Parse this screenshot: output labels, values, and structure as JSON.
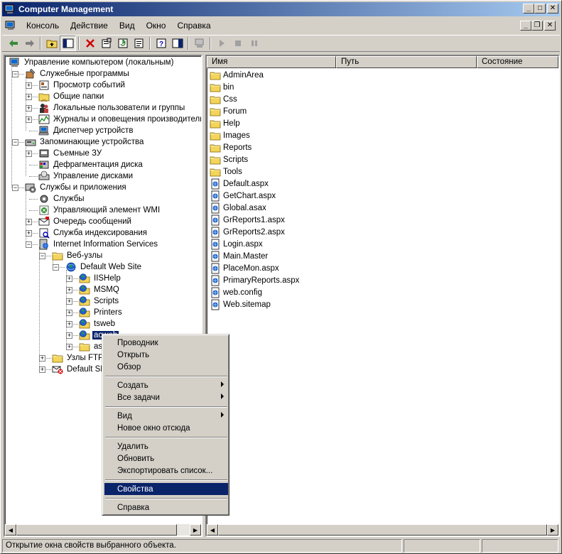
{
  "window": {
    "title": "Computer Management"
  },
  "menubar": {
    "items": [
      "Консоль",
      "Действие",
      "Вид",
      "Окно",
      "Справка"
    ]
  },
  "tree": {
    "items": [
      {
        "label": "Управление компьютером (локальным)",
        "icon": "computer-icon"
      },
      {
        "label": "Служебные программы",
        "icon": "tools-icon"
      },
      {
        "label": "Просмотр событий",
        "icon": "event-viewer-icon"
      },
      {
        "label": "Общие папки",
        "icon": "shared-folder-icon"
      },
      {
        "label": "Локальные пользователи и группы",
        "icon": "users-icon"
      },
      {
        "label": "Журналы и оповещения производительно",
        "icon": "performance-icon"
      },
      {
        "label": "Диспетчер устройств",
        "icon": "device-manager-icon"
      },
      {
        "label": "Запоминающие устройства",
        "icon": "storage-icon"
      },
      {
        "label": "Съемные ЗУ",
        "icon": "removable-storage-icon"
      },
      {
        "label": "Дефрагментация диска",
        "icon": "defrag-icon"
      },
      {
        "label": "Управление дисками",
        "icon": "disk-management-icon"
      },
      {
        "label": "Службы и приложения",
        "icon": "services-apps-icon"
      },
      {
        "label": "Службы",
        "icon": "services-icon"
      },
      {
        "label": "Управляющий элемент WMI",
        "icon": "wmi-icon"
      },
      {
        "label": "Очередь сообщений",
        "icon": "message-queue-icon"
      },
      {
        "label": "Служба индексирования",
        "icon": "indexing-icon"
      },
      {
        "label": "Internet Information Services",
        "icon": "iis-icon"
      },
      {
        "label": "Веб-узлы",
        "icon": "folder-icon"
      },
      {
        "label": "Default Web Site",
        "icon": "website-icon"
      },
      {
        "label": "IISHelp",
        "icon": "web-folder-icon"
      },
      {
        "label": "MSMQ",
        "icon": "web-folder-icon"
      },
      {
        "label": "Scripts",
        "icon": "web-folder-icon"
      },
      {
        "label": "Printers",
        "icon": "web-folder-icon"
      },
      {
        "label": "tsweb",
        "icon": "web-folder-icon"
      },
      {
        "label": "acweb",
        "icon": "web-folder-icon"
      },
      {
        "label": "aspn",
        "icon": "folder-icon"
      },
      {
        "label": "Узлы FTP",
        "icon": "folder-icon"
      },
      {
        "label": "Default SMT",
        "icon": "smtp-icon"
      }
    ]
  },
  "list": {
    "columns": [
      "Имя",
      "Путь",
      "Состояние"
    ],
    "rows": [
      {
        "name": "AdminArea",
        "icon": "folder-icon"
      },
      {
        "name": "bin",
        "icon": "folder-icon"
      },
      {
        "name": "Css",
        "icon": "folder-icon"
      },
      {
        "name": "Forum",
        "icon": "folder-icon"
      },
      {
        "name": "Help",
        "icon": "folder-icon"
      },
      {
        "name": "Images",
        "icon": "folder-icon"
      },
      {
        "name": "Reports",
        "icon": "folder-icon"
      },
      {
        "name": "Scripts",
        "icon": "folder-icon"
      },
      {
        "name": "Tools",
        "icon": "folder-icon"
      },
      {
        "name": "Default.aspx",
        "icon": "file-icon"
      },
      {
        "name": "GetChart.aspx",
        "icon": "file-icon"
      },
      {
        "name": "Global.asax",
        "icon": "file-icon"
      },
      {
        "name": "GrReports1.aspx",
        "icon": "file-icon"
      },
      {
        "name": "GrReports2.aspx",
        "icon": "file-icon"
      },
      {
        "name": "Login.aspx",
        "icon": "file-icon"
      },
      {
        "name": "Main.Master",
        "icon": "file-icon"
      },
      {
        "name": "PlaceMon.aspx",
        "icon": "file-icon"
      },
      {
        "name": "PrimaryReports.aspx",
        "icon": "file-icon"
      },
      {
        "name": "web.config",
        "icon": "file-icon"
      },
      {
        "name": "Web.sitemap",
        "icon": "file-icon"
      }
    ]
  },
  "context_menu": {
    "items": [
      {
        "label": "Проводник"
      },
      {
        "label": "Открыть"
      },
      {
        "label": "Обзор"
      },
      {
        "label": "Создать",
        "submenu": true
      },
      {
        "label": "Все задачи",
        "submenu": true
      },
      {
        "label": "Вид",
        "submenu": true
      },
      {
        "label": "Новое окно отсюда"
      },
      {
        "label": "Удалить"
      },
      {
        "label": "Обновить"
      },
      {
        "label": "Экспортировать список..."
      },
      {
        "label": "Свойства",
        "highlighted": true
      },
      {
        "label": "Справка"
      }
    ]
  },
  "statusbar": {
    "text": "Открытие окна свойств выбранного объекта."
  },
  "colors": {
    "selection": "#0a246a",
    "face": "#d4d0c8",
    "folder": "#f3d55b"
  }
}
